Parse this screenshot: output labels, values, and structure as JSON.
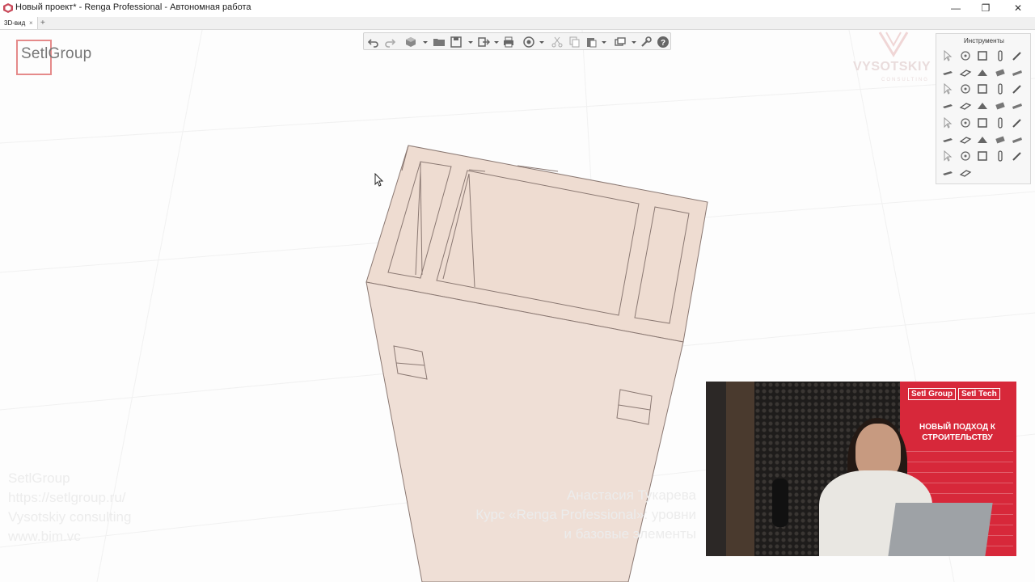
{
  "window": {
    "title": "Новый проект* - Renga Professional - Автономная работа",
    "minimize_glyph": "—",
    "maximize_glyph": "❐",
    "close_glyph": "✕"
  },
  "tabs": [
    {
      "label": "3D-вид",
      "close_glyph": "×",
      "active": true
    }
  ],
  "tab_add_glyph": "+",
  "toolbar": {
    "icons": [
      "undo-icon",
      "redo-icon",
      "view-cube-icon",
      "open-folder-icon",
      "save-icon",
      "export-icon",
      "print-icon",
      "orbit-icon",
      "cut-icon",
      "copy-icon",
      "paste-icon",
      "view-styles-icon",
      "settings-wrench-icon",
      "help-icon"
    ]
  },
  "logos": {
    "setlgroup": "SetlGroup",
    "vysotskiy": "VYSOTSKIY",
    "vysotskiy_sub": "CONSULTING"
  },
  "instruments": {
    "title": "Инструменты",
    "tools": [
      "select-tool",
      "axis-tool",
      "wall-tool",
      "column-tool",
      "line-tool",
      "floor-tool",
      "slab-tool",
      "roof-tool",
      "beam-tool",
      "plate-tool",
      "window-tool",
      "door-tool",
      "stair-tool",
      "opening-tool",
      "room-tool",
      "railing-tool",
      "equipment-tool",
      "line2d-tool",
      "rebar-tool",
      "element-tool",
      "pipe-tool",
      "duct-tool",
      "fitting-tool",
      "valve-tool",
      "terminal-tool",
      "grid-tool",
      "assembly-tool",
      "route-tool",
      "profile-tool",
      "material-tool",
      "level-tool",
      "section-tool",
      "dimension-tool",
      "mark-tool",
      "text-tool",
      "measure-tool",
      "group-tool"
    ]
  },
  "watermark": {
    "left_lines": [
      "SetlGroup",
      "https://setlgroup.ru/",
      "Vysotskiy consulting",
      "www.bim.vc"
    ],
    "right_lines": [
      "Анастасия Тукарева",
      "Курс «Renga Professional»: уровни",
      "и базовые элементы"
    ]
  },
  "webcam": {
    "banner_logo_1": "Setl Group",
    "banner_logo_2": "Setl Tech",
    "banner_slogan": "НОВЫЙ ПОДХОД К СТРОИТЕЛЬСТВУ"
  },
  "colors": {
    "model_fill": "#eedcd1",
    "model_stroke": "#8a7872",
    "accent_red": "#d7283a"
  }
}
